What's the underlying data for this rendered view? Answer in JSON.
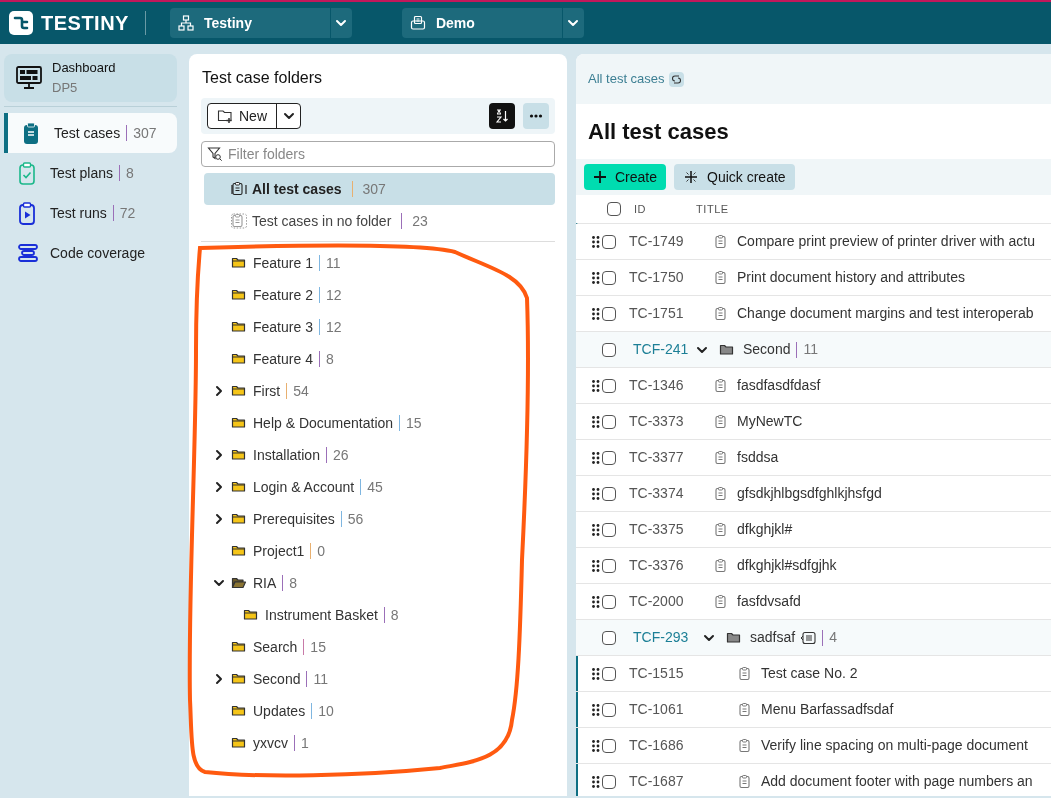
{
  "topbar": {
    "logo": "TESTINY",
    "workspace": "Testiny",
    "project": "Demo"
  },
  "sidebar": {
    "dashboard": {
      "label": "Dashboard",
      "subtitle": "DP5"
    },
    "items": [
      {
        "kind": "cases",
        "label": "Test cases",
        "count": "307",
        "selected": true
      },
      {
        "kind": "plans",
        "label": "Test plans",
        "count": "8",
        "selected": false
      },
      {
        "kind": "runs",
        "label": "Test runs",
        "count": "72",
        "selected": false
      },
      {
        "kind": "coverage",
        "label": "Code coverage",
        "selected": false
      }
    ]
  },
  "folders": {
    "title": "Test case folders",
    "new_button": "New",
    "filter_placeholder": "Filter folders",
    "special": [
      {
        "kind": "all",
        "label": "All test cases",
        "count": "307",
        "selected": true
      },
      {
        "kind": "none",
        "label": "Test cases in no folder",
        "count": "23",
        "selected": false
      }
    ],
    "tree": [
      {
        "name": "Feature 1",
        "count": "11",
        "color": "#7fb6e0",
        "expandable": false,
        "expanded": false
      },
      {
        "name": "Feature 2",
        "count": "12",
        "color": "#7fb6e0",
        "expandable": false,
        "expanded": false
      },
      {
        "name": "Feature 3",
        "count": "12",
        "color": "#7fb6e0",
        "expandable": false,
        "expanded": false
      },
      {
        "name": "Feature 4",
        "count": "8",
        "color": "#9b6fb8",
        "expandable": false,
        "expanded": false
      },
      {
        "name": "First",
        "count": "54",
        "color": "#e8b070",
        "expandable": true,
        "expanded": false
      },
      {
        "name": "Help & Documentation",
        "count": "15",
        "color": "#7fb6e0",
        "expandable": false,
        "expanded": false
      },
      {
        "name": "Installation",
        "count": "26",
        "color": "#9b6fb8",
        "expandable": true,
        "expanded": false
      },
      {
        "name": "Login & Account",
        "count": "45",
        "color": "#7fb6e0",
        "expandable": true,
        "expanded": false
      },
      {
        "name": "Prerequisites",
        "count": "56",
        "color": "#7fb6e0",
        "expandable": true,
        "expanded": false
      },
      {
        "name": "Project1",
        "count": "0",
        "color": "#e8b070",
        "expandable": false,
        "expanded": false
      },
      {
        "name": "RIA",
        "count": "8",
        "color": "#9b6fb8",
        "expandable": true,
        "expanded": true,
        "children": [
          {
            "name": "Instrument Basket",
            "count": "8",
            "color": "#9b6fb8",
            "expandable": false,
            "expanded": false
          }
        ]
      },
      {
        "name": "Search",
        "count": "15",
        "color": "#c87aa8",
        "expandable": false,
        "expanded": false
      },
      {
        "name": "Second",
        "count": "11",
        "color": "#9b6fb8",
        "expandable": true,
        "expanded": false
      },
      {
        "name": "Updates",
        "count": "10",
        "color": "#7fb6e0",
        "expandable": false,
        "expanded": false
      },
      {
        "name": "yxvcv",
        "count": "1",
        "color": "#9b6fb8",
        "expandable": false,
        "expanded": false
      }
    ]
  },
  "main": {
    "breadcrumb": "All test cases",
    "title": "All test cases",
    "create_button": "Create",
    "quick_create_button": "Quick create",
    "table": {
      "columns": [
        "ID",
        "TITLE"
      ],
      "select_all_checked": false,
      "rows": [
        {
          "kind": "continued",
          "children": [
            {
              "kind": "case",
              "id": "TC-1749",
              "title": "Compare print preview of printer driver with actu",
              "checked": false
            },
            {
              "kind": "case",
              "id": "TC-1750",
              "title": "Print document history and attributes",
              "checked": false
            },
            {
              "kind": "case",
              "id": "TC-1751",
              "title": "Change document margins and test interoperab",
              "checked": false
            }
          ]
        },
        {
          "kind": "folder",
          "id": "TCF-241",
          "title": "Second",
          "count": "11",
          "has_description": false,
          "expanded": true,
          "checked": false,
          "children": [
            {
              "kind": "case",
              "id": "TC-1346",
              "title": "fasdfasdfdasf",
              "checked": false
            },
            {
              "kind": "case",
              "id": "TC-3373",
              "title": "MyNewTC",
              "checked": false
            },
            {
              "kind": "case",
              "id": "TC-3377",
              "title": "fsddsa",
              "checked": false
            },
            {
              "kind": "case",
              "id": "TC-3374",
              "title": "gfsdkjhlbgsdfghlkjhsfgd",
              "checked": false
            },
            {
              "kind": "case",
              "id": "TC-3375",
              "title": "dfkghjkl#",
              "checked": false
            },
            {
              "kind": "case",
              "id": "TC-3376",
              "title": "dfkghjkl#sdfgjhk",
              "checked": false
            },
            {
              "kind": "case",
              "id": "TC-2000",
              "title": "fasfdvsafd",
              "checked": false
            },
            {
              "kind": "folder",
              "id": "TCF-293",
              "title": "sadfsaf",
              "count": "4",
              "has_description": true,
              "expanded": true,
              "checked": false,
              "children": [
                {
                  "kind": "case",
                  "id": "TC-1515",
                  "title": "Test case No. 2",
                  "checked": false
                },
                {
                  "kind": "case",
                  "id": "TC-1061",
                  "title": "Menu Barfassadfsdaf",
                  "checked": false
                },
                {
                  "kind": "case",
                  "id": "TC-1686",
                  "title": "Verify line spacing on multi-page document",
                  "checked": false
                },
                {
                  "kind": "case",
                  "id": "TC-1687",
                  "title": "Add document footer with page numbers an",
                  "checked": false
                }
              ]
            }
          ]
        }
      ]
    }
  }
}
